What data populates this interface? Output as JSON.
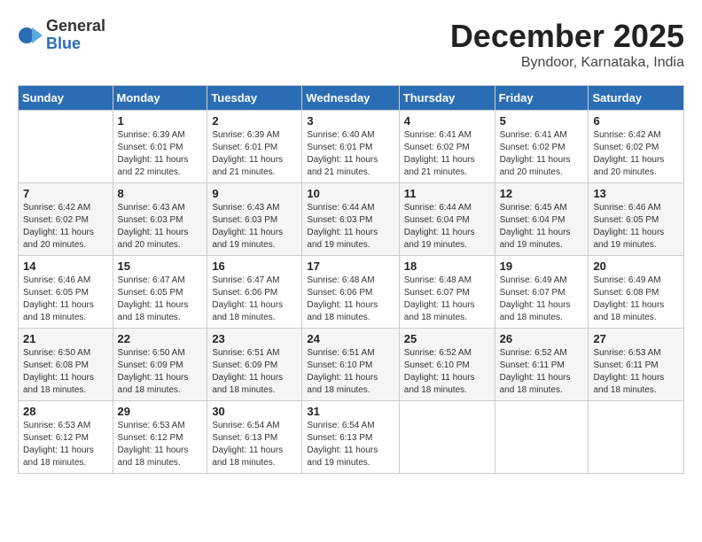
{
  "logo": {
    "general": "General",
    "blue": "Blue"
  },
  "title": "December 2025",
  "location": "Byndoor, Karnataka, India",
  "days_of_week": [
    "Sunday",
    "Monday",
    "Tuesday",
    "Wednesday",
    "Thursday",
    "Friday",
    "Saturday"
  ],
  "weeks": [
    [
      {
        "num": "",
        "info": ""
      },
      {
        "num": "1",
        "info": "Sunrise: 6:39 AM\nSunset: 6:01 PM\nDaylight: 11 hours\nand 22 minutes."
      },
      {
        "num": "2",
        "info": "Sunrise: 6:39 AM\nSunset: 6:01 PM\nDaylight: 11 hours\nand 21 minutes."
      },
      {
        "num": "3",
        "info": "Sunrise: 6:40 AM\nSunset: 6:01 PM\nDaylight: 11 hours\nand 21 minutes."
      },
      {
        "num": "4",
        "info": "Sunrise: 6:41 AM\nSunset: 6:02 PM\nDaylight: 11 hours\nand 21 minutes."
      },
      {
        "num": "5",
        "info": "Sunrise: 6:41 AM\nSunset: 6:02 PM\nDaylight: 11 hours\nand 20 minutes."
      },
      {
        "num": "6",
        "info": "Sunrise: 6:42 AM\nSunset: 6:02 PM\nDaylight: 11 hours\nand 20 minutes."
      }
    ],
    [
      {
        "num": "7",
        "info": "Sunrise: 6:42 AM\nSunset: 6:02 PM\nDaylight: 11 hours\nand 20 minutes."
      },
      {
        "num": "8",
        "info": "Sunrise: 6:43 AM\nSunset: 6:03 PM\nDaylight: 11 hours\nand 20 minutes."
      },
      {
        "num": "9",
        "info": "Sunrise: 6:43 AM\nSunset: 6:03 PM\nDaylight: 11 hours\nand 19 minutes."
      },
      {
        "num": "10",
        "info": "Sunrise: 6:44 AM\nSunset: 6:03 PM\nDaylight: 11 hours\nand 19 minutes."
      },
      {
        "num": "11",
        "info": "Sunrise: 6:44 AM\nSunset: 6:04 PM\nDaylight: 11 hours\nand 19 minutes."
      },
      {
        "num": "12",
        "info": "Sunrise: 6:45 AM\nSunset: 6:04 PM\nDaylight: 11 hours\nand 19 minutes."
      },
      {
        "num": "13",
        "info": "Sunrise: 6:46 AM\nSunset: 6:05 PM\nDaylight: 11 hours\nand 19 minutes."
      }
    ],
    [
      {
        "num": "14",
        "info": "Sunrise: 6:46 AM\nSunset: 6:05 PM\nDaylight: 11 hours\nand 18 minutes."
      },
      {
        "num": "15",
        "info": "Sunrise: 6:47 AM\nSunset: 6:05 PM\nDaylight: 11 hours\nand 18 minutes."
      },
      {
        "num": "16",
        "info": "Sunrise: 6:47 AM\nSunset: 6:06 PM\nDaylight: 11 hours\nand 18 minutes."
      },
      {
        "num": "17",
        "info": "Sunrise: 6:48 AM\nSunset: 6:06 PM\nDaylight: 11 hours\nand 18 minutes."
      },
      {
        "num": "18",
        "info": "Sunrise: 6:48 AM\nSunset: 6:07 PM\nDaylight: 11 hours\nand 18 minutes."
      },
      {
        "num": "19",
        "info": "Sunrise: 6:49 AM\nSunset: 6:07 PM\nDaylight: 11 hours\nand 18 minutes."
      },
      {
        "num": "20",
        "info": "Sunrise: 6:49 AM\nSunset: 6:08 PM\nDaylight: 11 hours\nand 18 minutes."
      }
    ],
    [
      {
        "num": "21",
        "info": "Sunrise: 6:50 AM\nSunset: 6:08 PM\nDaylight: 11 hours\nand 18 minutes."
      },
      {
        "num": "22",
        "info": "Sunrise: 6:50 AM\nSunset: 6:09 PM\nDaylight: 11 hours\nand 18 minutes."
      },
      {
        "num": "23",
        "info": "Sunrise: 6:51 AM\nSunset: 6:09 PM\nDaylight: 11 hours\nand 18 minutes."
      },
      {
        "num": "24",
        "info": "Sunrise: 6:51 AM\nSunset: 6:10 PM\nDaylight: 11 hours\nand 18 minutes."
      },
      {
        "num": "25",
        "info": "Sunrise: 6:52 AM\nSunset: 6:10 PM\nDaylight: 11 hours\nand 18 minutes."
      },
      {
        "num": "26",
        "info": "Sunrise: 6:52 AM\nSunset: 6:11 PM\nDaylight: 11 hours\nand 18 minutes."
      },
      {
        "num": "27",
        "info": "Sunrise: 6:53 AM\nSunset: 6:11 PM\nDaylight: 11 hours\nand 18 minutes."
      }
    ],
    [
      {
        "num": "28",
        "info": "Sunrise: 6:53 AM\nSunset: 6:12 PM\nDaylight: 11 hours\nand 18 minutes."
      },
      {
        "num": "29",
        "info": "Sunrise: 6:53 AM\nSunset: 6:12 PM\nDaylight: 11 hours\nand 18 minutes."
      },
      {
        "num": "30",
        "info": "Sunrise: 6:54 AM\nSunset: 6:13 PM\nDaylight: 11 hours\nand 18 minutes."
      },
      {
        "num": "31",
        "info": "Sunrise: 6:54 AM\nSunset: 6:13 PM\nDaylight: 11 hours\nand 19 minutes."
      },
      {
        "num": "",
        "info": ""
      },
      {
        "num": "",
        "info": ""
      },
      {
        "num": "",
        "info": ""
      }
    ]
  ]
}
